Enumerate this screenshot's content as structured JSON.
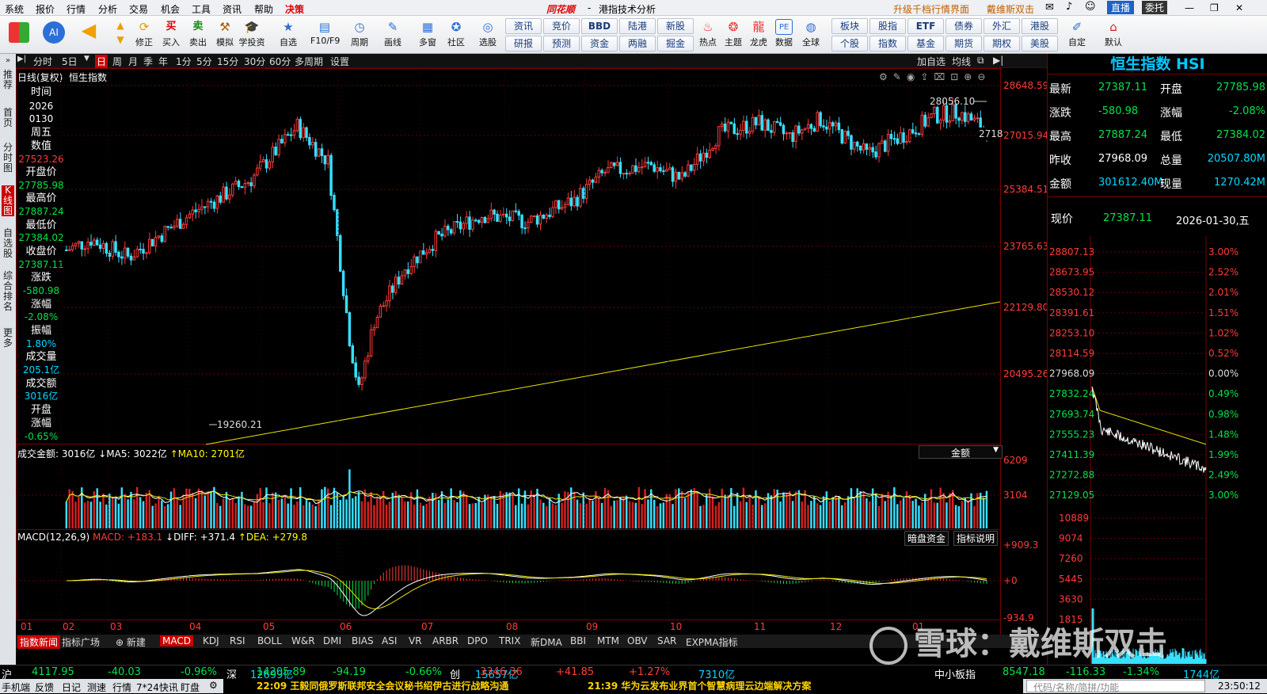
{
  "menu": {
    "items": [
      "系统",
      "报价",
      "行情",
      "分析",
      "交易",
      "机会",
      "工具",
      "资讯",
      "帮助",
      "决策"
    ],
    "brand": "同花顺",
    "sep": "-",
    "subtitle": "港指技术分析",
    "right_link1": "升级千档行情界面",
    "right_link2": "戴维斯双击",
    "direct": "直播",
    "entrust": "委托"
  },
  "toolbar": {
    "buttons": [
      "修正",
      "买入",
      "卖出",
      "模拟",
      "学投资",
      "自选",
      "F10/F9",
      "周期",
      "画线",
      "多窗",
      "社区",
      "选股"
    ],
    "grid": [
      [
        "资讯",
        "竞价",
        "BBD",
        "陆港",
        "新股"
      ],
      [
        "研报",
        "预测",
        "资金",
        "两融",
        "掘金"
      ]
    ],
    "buttons2": [
      "热点",
      "主题",
      "龙虎",
      "数据",
      "全球"
    ],
    "grid2": [
      [
        "板块",
        "股指",
        "ETF",
        "债券",
        "外汇",
        "港股"
      ],
      [
        "个股",
        "指数",
        "基金",
        "期货",
        "期权",
        "美股"
      ]
    ],
    "buttons3": [
      "自定",
      "默认"
    ]
  },
  "leftbar": [
    "推荐",
    "首页",
    "分时图",
    "K线图",
    "自选股",
    "综合排名",
    "更多"
  ],
  "periods": [
    "分时",
    "5日",
    "日",
    "周",
    "月",
    "季",
    "年",
    "1分",
    "5分",
    "15分",
    "30分",
    "60分",
    "多周期",
    "设置"
  ],
  "period_active": "日",
  "chart_title": "日线(复权)  恒生指数",
  "chart_right": [
    "加自选",
    "均线"
  ],
  "price_axis": [
    "28648.59",
    "27015.94",
    "25384.51",
    "23765.63",
    "22129.80",
    "20495.26"
  ],
  "annot_high": "28056.10",
  "annot_low": "19260.21",
  "annot_last": "2718",
  "info": {
    "time_label": "时间",
    "date1": "2026",
    "date2": "0130",
    "weekday": "周五",
    "value_label": "数值",
    "value": "27523.26",
    "open_label": "开盘价",
    "open": "27785.98",
    "high_label": "最高价",
    "high": "27887.24",
    "low_label": "最低价",
    "low": "27384.02",
    "close_label": "收盘价",
    "close": "27387.11",
    "chg_label": "涨跌",
    "chg": "-580.98",
    "pct_label": "涨幅",
    "pct": "-2.08%",
    "amp_label": "振幅",
    "amp": "1.80%",
    "vol_label": "成交量",
    "vol": "205.1亿",
    "amt_label": "成交额",
    "amt": "3016亿",
    "open_chg_label1": "开盘",
    "open_chg_label2": "涨幅",
    "open_chg": "-0.65%"
  },
  "volume": {
    "label": "成交金额: 3016亿",
    "ma5": "↓MA5: 3022亿",
    "ma10": "↑MA10: 2701亿",
    "selector": "金额",
    "axis": [
      "6209",
      "3104"
    ]
  },
  "macd": {
    "label": "MACD(12,26,9)",
    "macd": "MACD: +183.1",
    "diff": "↓DIFF: +371.4",
    "dea": "↑DEA: +279.8",
    "btn1": "暗盘资金",
    "btn2": "指标说明",
    "axis": [
      "+909.3",
      "+0",
      "-934.9"
    ]
  },
  "months": [
    "01",
    "02",
    "03",
    "04",
    "05",
    "06",
    "07",
    "08",
    "09",
    "10",
    "11",
    "12",
    "01"
  ],
  "ind_tabs": [
    "指数新闻",
    "指标广场",
    "新建",
    "MACD",
    "KDJ",
    "RSI",
    "BOLL",
    "W&R",
    "DMI",
    "BIAS",
    "ASI",
    "VR",
    "ARBR",
    "DPO",
    "TRIX",
    "新DMA",
    "BBI",
    "MTM",
    "OBV",
    "SAR",
    "EXPMA指标"
  ],
  "ind_active": "MACD",
  "quote": {
    "title": "恒生指数 HSI",
    "rows": [
      [
        "最新",
        "27387.11",
        "开盘",
        "27785.98"
      ],
      [
        "涨跌",
        "-580.98",
        "涨幅",
        "-2.08%"
      ],
      [
        "最高",
        "27887.24",
        "最低",
        "27384.02"
      ],
      [
        "昨收",
        "27968.09",
        "总量",
        "20507.80M"
      ],
      [
        "金额",
        "301612.40M",
        "现量",
        "1270.42M"
      ]
    ],
    "price_label": "现价",
    "price": "27387.11",
    "date": "2026-01-30,五"
  },
  "intraday": {
    "left_axis": [
      "28807.13",
      "28673.95",
      "28530.12",
      "28391.61",
      "28253.10",
      "28114.59",
      "27968.09",
      "27832.24",
      "27693.74",
      "27555.23",
      "27411.39",
      "27272.88",
      "27129.05"
    ],
    "right_axis": [
      "3.00%",
      "2.52%",
      "2.01%",
      "1.51%",
      "1.02%",
      "0.52%",
      "0.00%",
      "0.49%",
      "0.98%",
      "1.48%",
      "1.99%",
      "2.49%",
      "3.00%"
    ],
    "vol_axis": [
      "10889",
      "9074",
      "7260",
      "5445",
      "3630",
      "1815"
    ]
  },
  "status": [
    {
      "name": "沪",
      "v1": "4117.95",
      "v2": "-40.03",
      "v3": "-0.96%",
      "v4": "12699亿"
    },
    {
      "name": "深",
      "v1": "14205.89",
      "v2": "-94.19",
      "v3": "-0.66%",
      "v4": "15657亿"
    },
    {
      "name": "创",
      "v1": "3346.36",
      "v2": "+41.85",
      "v3": "+1.27%",
      "v4": "7310亿"
    }
  ],
  "status_extra": {
    "label": "中小板指",
    "v1": "8547.18",
    "v2": "-116.33",
    "v3": "-1.34%",
    "v4": "1744亿"
  },
  "bottom": {
    "items": [
      "手机端",
      "反馈",
      "日记",
      "测速",
      "行情",
      "7*24快讯",
      "盯盘"
    ],
    "news1": "22:09 王毅同俄罗斯联邦安全会议秘书绍伊古进行战略沟通",
    "news2": "21:39 华为云发布业界首个智慧病理云边端解决方案",
    "search": "代码/名称/简拼/功能",
    "clock": "23:50:12"
  },
  "watermark": "雪球：戴维斯双击"
}
